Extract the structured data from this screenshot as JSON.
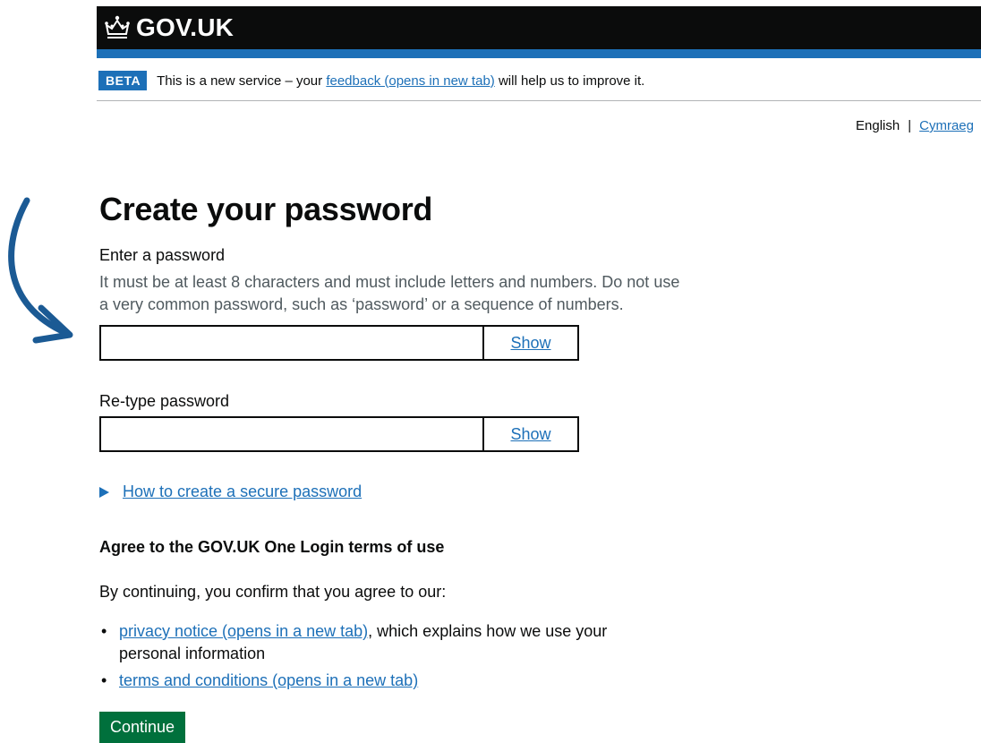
{
  "header": {
    "logo_text": "GOV.UK"
  },
  "beta_banner": {
    "tag": "BETA",
    "text_before": "This is a new service – your ",
    "link": "feedback (opens in new tab)",
    "text_after": " will help us to improve it."
  },
  "language": {
    "current": "English",
    "separator": "|",
    "other": "Cymraeg"
  },
  "page": {
    "title": "Create your password",
    "password_label": "Enter a password",
    "password_hint": "It must be at least 8 characters and must include letters and numbers. Do not use a very common password, such as ‘password’ or a sequence of numbers.",
    "password_value": "",
    "retype_label": "Re-type password",
    "retype_value": "",
    "show_label": "Show",
    "details_summary": "How to create a secure password",
    "terms_heading": "Agree to the GOV.UK One Login terms of use",
    "terms_intro": "By continuing, you confirm that you agree to our:",
    "privacy_link": "privacy notice (opens in a new tab)",
    "privacy_suffix": ", which explains how we use your personal information",
    "terms_link": "terms and conditions (opens in a new tab)",
    "continue_label": "Continue"
  },
  "colors": {
    "header_bg": "#0b0c0c",
    "brand_blue": "#1d70b8",
    "button_green": "#00703c",
    "hint_grey": "#505a5f"
  },
  "icons": {
    "logo": "crown-icon",
    "details": "triangle-right-icon",
    "annotation": "curved-arrow-icon"
  }
}
